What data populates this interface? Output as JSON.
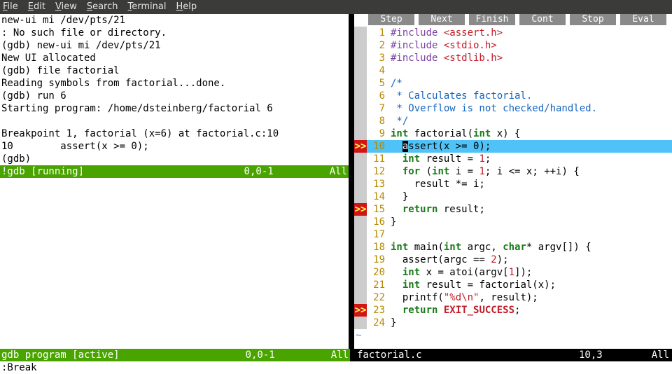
{
  "menu": {
    "items": [
      "File",
      "Edit",
      "View",
      "Search",
      "Terminal",
      "Help"
    ]
  },
  "gdb_lines": [
    "new-ui mi /dev/pts/21",
    ": No such file or directory.",
    "(gdb) new-ui mi /dev/pts/21",
    "New UI allocated",
    "(gdb) file factorial",
    "Reading symbols from factorial...done.",
    "(gdb) run 6",
    "Starting program: /home/dsteinberg/factorial 6",
    "",
    "Breakpoint 1, factorial (x=6) at factorial.c:10",
    "10        assert(x >= 0);",
    "(gdb)"
  ],
  "status_top": {
    "left": "!gdb [running]",
    "mid": "0,0-1",
    "right": "All"
  },
  "status_mid": {
    "left": "gdb program [active]",
    "mid": "0,0-1",
    "right": "All"
  },
  "status_right": {
    "left": "factorial.c",
    "mid": "10,3",
    "right": "All"
  },
  "cmdline": ":Break",
  "buttons": [
    "Step",
    "Next",
    "Finish",
    "Cont",
    "Stop",
    "Eval"
  ],
  "code": [
    {
      "n": 1,
      "bp": false,
      "tokens": [
        [
          "pp",
          "#include "
        ],
        [
          "inc",
          "<assert.h>"
        ]
      ]
    },
    {
      "n": 2,
      "bp": false,
      "tokens": [
        [
          "pp",
          "#include "
        ],
        [
          "inc",
          "<stdio.h>"
        ]
      ]
    },
    {
      "n": 3,
      "bp": false,
      "tokens": [
        [
          "pp",
          "#include "
        ],
        [
          "inc",
          "<stdlib.h>"
        ]
      ]
    },
    {
      "n": 4,
      "bp": false,
      "tokens": []
    },
    {
      "n": 5,
      "bp": false,
      "tokens": [
        [
          "cmt",
          "/*"
        ]
      ]
    },
    {
      "n": 6,
      "bp": false,
      "tokens": [
        [
          "cmt",
          " * Calculates factorial."
        ]
      ]
    },
    {
      "n": 7,
      "bp": false,
      "tokens": [
        [
          "cmt",
          " * Overflow is not checked/handled."
        ]
      ]
    },
    {
      "n": 8,
      "bp": false,
      "tokens": [
        [
          "cmt",
          " */"
        ]
      ]
    },
    {
      "n": 9,
      "bp": false,
      "tokens": [
        [
          "type",
          "int"
        ],
        [
          "",
          " factorial("
        ],
        [
          "type",
          "int"
        ],
        [
          "",
          " x) {"
        ]
      ]
    },
    {
      "n": 10,
      "bp": true,
      "hl": true,
      "cursor_at": 2,
      "tokens": [
        [
          "",
          "  assert(x >= "
        ],
        [
          "num",
          "0"
        ],
        [
          "",
          ");"
        ]
      ]
    },
    {
      "n": 11,
      "bp": false,
      "tokens": [
        [
          "",
          "  "
        ],
        [
          "type",
          "int"
        ],
        [
          "",
          " result = "
        ],
        [
          "num",
          "1"
        ],
        [
          "",
          ";"
        ]
      ]
    },
    {
      "n": 12,
      "bp": false,
      "tokens": [
        [
          "",
          "  "
        ],
        [
          "kw",
          "for"
        ],
        [
          "",
          " ("
        ],
        [
          "type",
          "int"
        ],
        [
          "",
          " i = "
        ],
        [
          "num",
          "1"
        ],
        [
          "",
          "; i <= x; ++i) {"
        ]
      ]
    },
    {
      "n": 13,
      "bp": false,
      "tokens": [
        [
          "",
          "    result *= i;"
        ]
      ]
    },
    {
      "n": 14,
      "bp": false,
      "tokens": [
        [
          "",
          "  }"
        ]
      ]
    },
    {
      "n": 15,
      "bp": true,
      "tokens": [
        [
          "",
          "  "
        ],
        [
          "kw",
          "return"
        ],
        [
          "",
          " result;"
        ]
      ]
    },
    {
      "n": 16,
      "bp": false,
      "tokens": [
        [
          "",
          "}"
        ]
      ]
    },
    {
      "n": 17,
      "bp": false,
      "tokens": []
    },
    {
      "n": 18,
      "bp": false,
      "tokens": [
        [
          "type",
          "int"
        ],
        [
          "",
          " main("
        ],
        [
          "type",
          "int"
        ],
        [
          "",
          " argc, "
        ],
        [
          "type",
          "char"
        ],
        [
          "",
          "* argv[]) {"
        ]
      ]
    },
    {
      "n": 19,
      "bp": false,
      "tokens": [
        [
          "",
          "  assert(argc == "
        ],
        [
          "num",
          "2"
        ],
        [
          "",
          ");"
        ]
      ]
    },
    {
      "n": 20,
      "bp": false,
      "tokens": [
        [
          "",
          "  "
        ],
        [
          "type",
          "int"
        ],
        [
          "",
          " x = atoi(argv["
        ],
        [
          "num",
          "1"
        ],
        [
          "",
          "]);"
        ]
      ]
    },
    {
      "n": 21,
      "bp": false,
      "tokens": [
        [
          "",
          "  "
        ],
        [
          "type",
          "int"
        ],
        [
          "",
          " result = factorial(x);"
        ]
      ]
    },
    {
      "n": 22,
      "bp": false,
      "tokens": [
        [
          "",
          "  printf("
        ],
        [
          "str",
          "\"%d\\n\""
        ],
        [
          "",
          "",
          ", result);"
        ]
      ]
    },
    {
      "n": 23,
      "bp": true,
      "tokens": [
        [
          "",
          "  "
        ],
        [
          "kw",
          "return"
        ],
        [
          "",
          " "
        ],
        [
          "const",
          "EXIT_SUCCESS"
        ],
        [
          "",
          ";"
        ]
      ]
    },
    {
      "n": 24,
      "bp": false,
      "tokens": [
        [
          "",
          "}"
        ]
      ]
    }
  ]
}
